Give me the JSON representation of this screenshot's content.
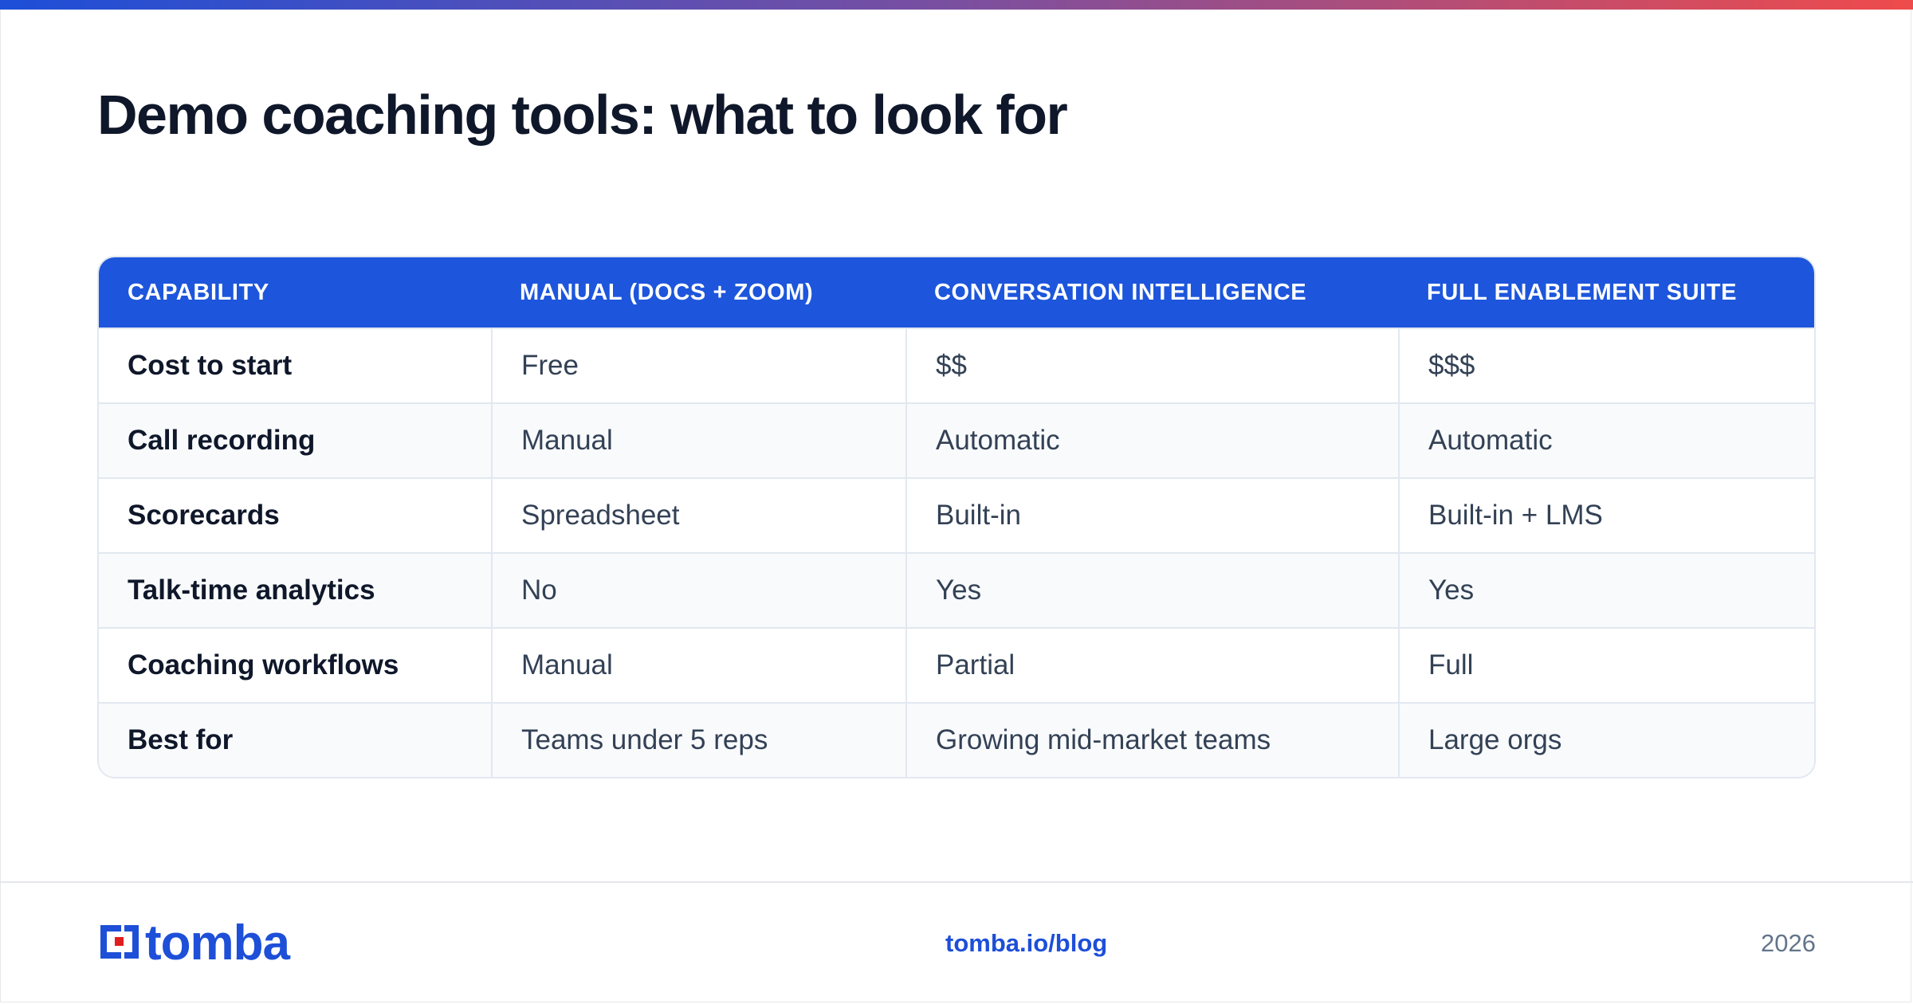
{
  "title": "Demo coaching tools: what to look for",
  "colors": {
    "accent": "#1d56dc",
    "gradient_start": "#1d4fd8",
    "gradient_end": "#ef4b4b",
    "logo_red": "#e11d1d"
  },
  "table": {
    "headers": [
      "CAPABILITY",
      "MANUAL (DOCS + ZOOM)",
      "CONVERSATION INTELLIGENCE",
      "FULL ENABLEMENT SUITE"
    ],
    "rows": [
      [
        "Cost to start",
        "Free",
        "$$",
        "$$$"
      ],
      [
        "Call recording",
        "Manual",
        "Automatic",
        "Automatic"
      ],
      [
        "Scorecards",
        "Spreadsheet",
        "Built-in",
        "Built-in + LMS"
      ],
      [
        "Talk-time analytics",
        "No",
        "Yes",
        "Yes"
      ],
      [
        "Coaching workflows",
        "Manual",
        "Partial",
        "Full"
      ],
      [
        "Best for",
        "Teams under 5 reps",
        "Growing mid-market teams",
        "Large orgs"
      ]
    ]
  },
  "footer": {
    "logo_text": "tomba",
    "logo_icon": "tomba-bracket-icon",
    "link": "tomba.io/blog",
    "year": "2026"
  }
}
